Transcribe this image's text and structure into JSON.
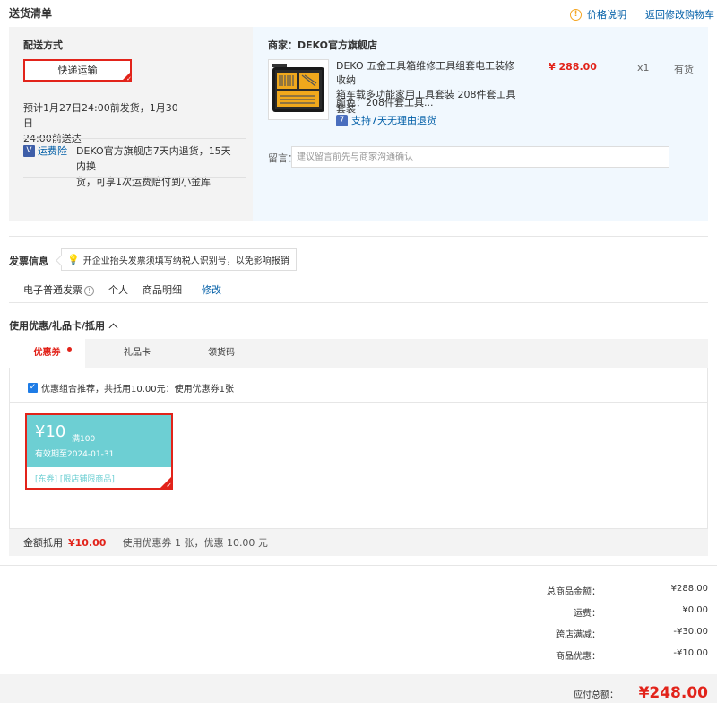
{
  "header": {
    "title": "送货清单",
    "price_info": "价格说明",
    "back_cart": "返回修改购物车"
  },
  "shipping": {
    "label": "配送方式",
    "method": "快递运输",
    "time_line1": "预计1月27日24:00前发货，1月30日",
    "time_line2": "24:00前送达",
    "insurance_label": "运费险",
    "insurance_text_line1": "DEKO官方旗舰店7天内退货，15天内换",
    "insurance_text_line2": "货，可享1次运费赔付到小金库"
  },
  "product": {
    "merchant": "商家：DEKO官方旗舰店",
    "title_line1": "DEKO 五金工具箱维修工具组套电工装修收纳",
    "title_line2": "箱车载多功能家用工具套装 208件套工具套装",
    "price": "¥ 288.00",
    "qty": "x1",
    "stock": "有货",
    "color": "颜色：208件套工具...",
    "return_policy": "支持7天无理由退货",
    "message_label": "留言：",
    "message_placeholder": "建议留言前先与商家沟通确认"
  },
  "invoice": {
    "title": "发票信息",
    "tip": "开企业抬头发票须填写纳税人识别号，以免影响报销",
    "type": "电子普通发票",
    "person": "个人",
    "detail": "商品明细",
    "edit": "修改"
  },
  "coupons": {
    "title": "使用优惠/礼品卡/抵用",
    "tabs": [
      "优惠券",
      "礼品卡",
      "领货码"
    ],
    "combo_text": "优惠组合推荐，共抵用10.00元：使用优惠券1张",
    "card": {
      "amount": "¥10",
      "condition": "满100",
      "expiry": "有效期至2024-01-31",
      "tags": "[东券]  [限店铺限商品]"
    },
    "deduct_label": "金额抵用",
    "deduct_amount": "¥10.00",
    "deduct_desc": "使用优惠券 1 张，优惠 10.00 元"
  },
  "totals": {
    "rows": [
      {
        "label": "总商品金额：",
        "value": "¥288.00"
      },
      {
        "label": "运费：",
        "value": "¥0.00"
      },
      {
        "label": "跨店满减：",
        "value": "-¥30.00"
      },
      {
        "label": "商品优惠：",
        "value": "-¥10.00"
      }
    ],
    "grand_label": "应付总额：",
    "grand_value": "¥248.00"
  },
  "colors": {
    "accent": "#e2231a",
    "link": "#005ea7",
    "coupon": "#6dcfd3"
  }
}
